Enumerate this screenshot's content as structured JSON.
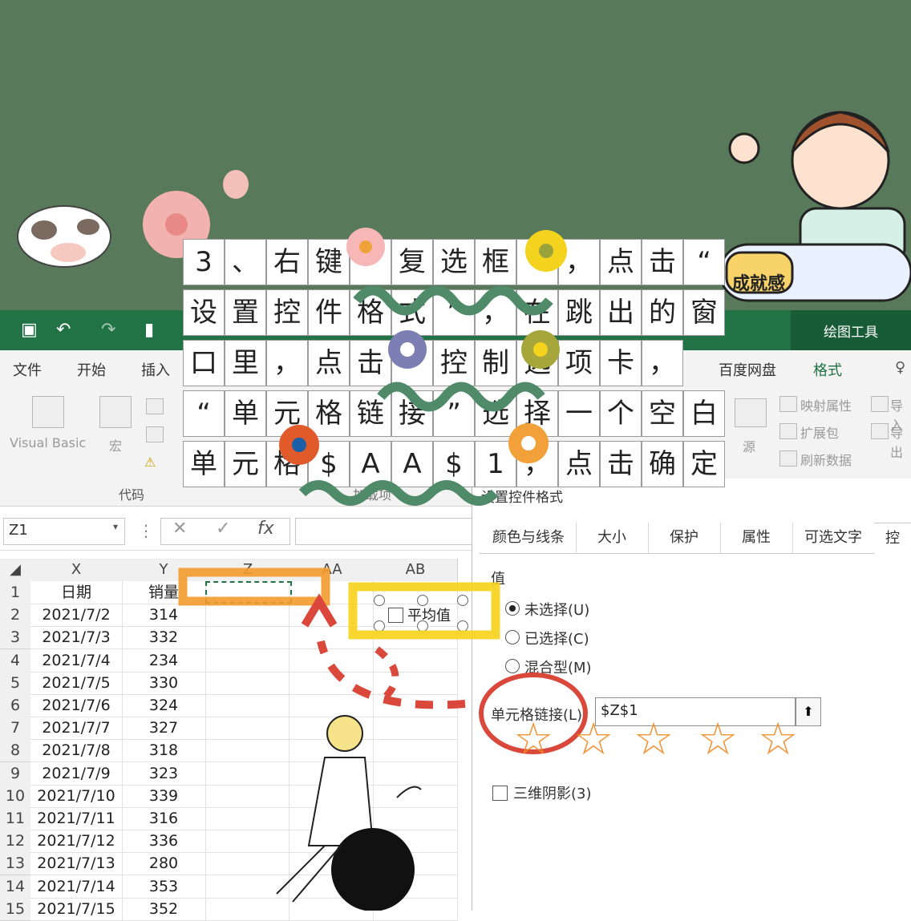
{
  "colors": {
    "board": "#58795a",
    "excel_green": "#217346",
    "accent_orange": "#f08a24",
    "accent_yellow": "#f4d31e",
    "accent_red": "#d9483b"
  },
  "caption": [
    [
      "3",
      "、",
      "右",
      "键",
      "",
      "复",
      "选",
      "框",
      "",
      "，",
      "点",
      "击",
      "“"
    ],
    [
      "设",
      "置",
      "控",
      "件",
      "格",
      "式",
      "”",
      "，",
      "在",
      "跳",
      "出",
      "的",
      "窗"
    ],
    [
      "口",
      "里",
      "，",
      "点",
      "击",
      "",
      "控",
      "制",
      "选",
      "项",
      "卡",
      "，"
    ],
    [
      "“",
      "单",
      "元",
      "格",
      "链",
      "接",
      "”",
      "选",
      "择",
      "一",
      "个",
      "空",
      "白"
    ],
    [
      "单",
      "元",
      "格",
      "$",
      "A",
      "A",
      "$",
      "1",
      "，",
      "点",
      "击",
      "确",
      "定"
    ]
  ],
  "sticker": {
    "achievement": "成就感"
  },
  "excel": {
    "drawing_tools": "绘图工具",
    "menu": [
      "文件",
      "开始",
      "插入",
      "百度网盘",
      "格式"
    ],
    "ribbon": {
      "visual_basic": "Visual Basic",
      "macro": "宏",
      "code_group": "代码",
      "addins_group": "加载项",
      "source": "源",
      "map_properties": "映射属性",
      "expansion_pack": "扩展包",
      "refresh_data": "刷新数据",
      "import": "导入",
      "export": "导出"
    },
    "name_box": "Z1",
    "fx": "fx",
    "columns": [
      "X",
      "Y",
      "Z",
      "AA",
      "AB"
    ],
    "header_row": {
      "row": "1",
      "x": "日期",
      "y": "销量"
    },
    "rows": [
      {
        "n": "2",
        "date": "2021/7/2",
        "sales": "314"
      },
      {
        "n": "3",
        "date": "2021/7/3",
        "sales": "332"
      },
      {
        "n": "4",
        "date": "2021/7/4",
        "sales": "234"
      },
      {
        "n": "5",
        "date": "2021/7/5",
        "sales": "330"
      },
      {
        "n": "6",
        "date": "2021/7/6",
        "sales": "324"
      },
      {
        "n": "7",
        "date": "2021/7/7",
        "sales": "327"
      },
      {
        "n": "8",
        "date": "2021/7/8",
        "sales": "318"
      },
      {
        "n": "9",
        "date": "2021/7/9",
        "sales": "323"
      },
      {
        "n": "10",
        "date": "2021/7/10",
        "sales": "339"
      },
      {
        "n": "11",
        "date": "2021/7/11",
        "sales": "316"
      },
      {
        "n": "12",
        "date": "2021/7/12",
        "sales": "336"
      },
      {
        "n": "13",
        "date": "2021/7/13",
        "sales": "280"
      },
      {
        "n": "14",
        "date": "2021/7/14",
        "sales": "353"
      },
      {
        "n": "15",
        "date": "2021/7/15",
        "sales": "352"
      }
    ],
    "checkbox_label": "平均值"
  },
  "dialog": {
    "title": "设置控件格式",
    "tabs": [
      "颜色与线条",
      "大小",
      "保护",
      "属性",
      "可选文字",
      "控"
    ],
    "value_group": "值",
    "unchecked": "未选择(U)",
    "checked": "已选择(C)",
    "mixed": "混合型(M)",
    "cell_link_label": "单元格链接(L):",
    "cell_link_value": "$Z$1",
    "shading_3d": "三维阴影(3)"
  }
}
